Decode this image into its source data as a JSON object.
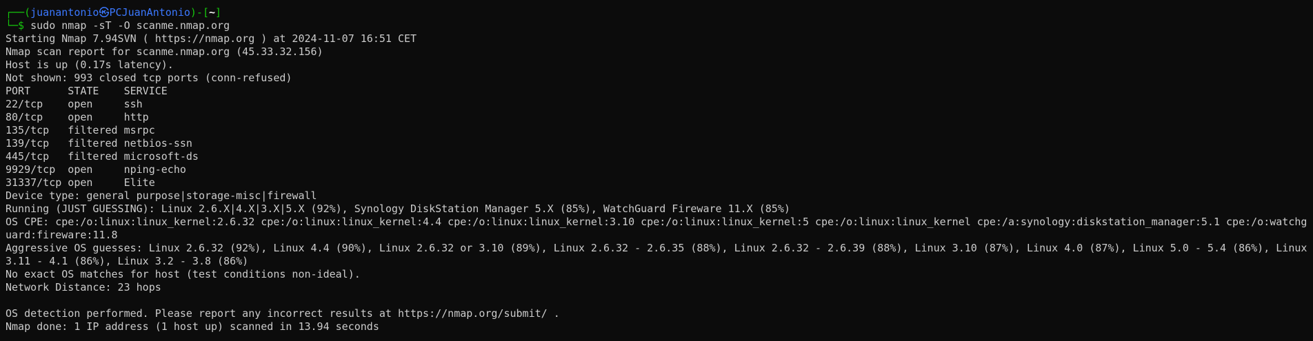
{
  "colors": {
    "background": "#0c0c0c",
    "foreground": "#cccccc",
    "prompt_frame": "#16c60c",
    "prompt_user_host": "#3b78ff",
    "prompt_dir": "#f2f2f2"
  },
  "prompt": {
    "frame_start": "┌──(",
    "user": "juanantonio",
    "at_symbol": "㉿",
    "host": "PCJuanAntonio",
    "frame_mid": ")-[",
    "dir": "~",
    "frame_end": "]",
    "frame_second": "└─$",
    "command": " sudo nmap -sT -O scanme.nmap.org"
  },
  "output": {
    "line1": "Starting Nmap 7.94SVN ( https://nmap.org ) at 2024-11-07 16:51 CET",
    "line2": "Nmap scan report for scanme.nmap.org (45.33.32.156)",
    "line3": "Host is up (0.17s latency).",
    "line4": "Not shown: 993 closed tcp ports (conn-refused)",
    "table_header": "PORT      STATE    SERVICE",
    "ports": [
      "22/tcp    open     ssh",
      "80/tcp    open     http",
      "135/tcp   filtered msrpc",
      "139/tcp   filtered netbios-ssn",
      "445/tcp   filtered microsoft-ds",
      "9929/tcp  open     nping-echo",
      "31337/tcp open     Elite"
    ],
    "device_type": "Device type: general purpose|storage-misc|firewall",
    "running": "Running (JUST GUESSING): Linux 2.6.X|4.X|3.X|5.X (92%), Synology DiskStation Manager 5.X (85%), WatchGuard Fireware 11.X (85%)",
    "os_cpe": "OS CPE: cpe:/o:linux:linux_kernel:2.6.32 cpe:/o:linux:linux_kernel:4.4 cpe:/o:linux:linux_kernel:3.10 cpe:/o:linux:linux_kernel:5 cpe:/o:linux:linux_kernel cpe:/a:synology:diskstation_manager:5.1 cpe:/o:watchguard:fireware:11.8",
    "aggressive": "Aggressive OS guesses: Linux 2.6.32 (92%), Linux 4.4 (90%), Linux 2.6.32 or 3.10 (89%), Linux 2.6.32 - 2.6.35 (88%), Linux 2.6.32 - 2.6.39 (88%), Linux 3.10 (87%), Linux 4.0 (87%), Linux 5.0 - 5.4 (86%), Linux 3.11 - 4.1 (86%), Linux 3.2 - 3.8 (86%)",
    "no_exact": "No exact OS matches for host (test conditions non-ideal).",
    "network_distance": "Network Distance: 23 hops",
    "os_detection": "OS detection performed. Please report any incorrect results at https://nmap.org/submit/ .",
    "done": "Nmap done: 1 IP address (1 host up) scanned in 13.94 seconds"
  }
}
